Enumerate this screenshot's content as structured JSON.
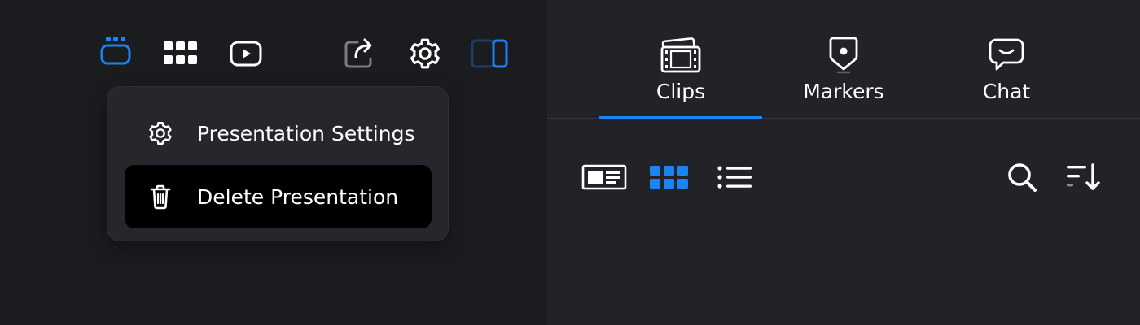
{
  "toolbar": {
    "icons": [
      "sessions-icon",
      "grid-icon",
      "play-icon",
      "share-icon",
      "settings-gear-icon",
      "panel-toggle-icon"
    ]
  },
  "menu": {
    "items": [
      {
        "label": "Presentation Settings",
        "icon": "gear-icon",
        "active": false
      },
      {
        "label": "Delete Presentation",
        "icon": "trash-icon",
        "active": true
      }
    ]
  },
  "tabs": [
    {
      "label": "Clips",
      "icon": "clips-film-icon",
      "selected": true
    },
    {
      "label": "Markers",
      "icon": "marker-pin-icon",
      "selected": false
    },
    {
      "label": "Chat",
      "icon": "chat-bubble-icon",
      "selected": false
    }
  ],
  "view_toolbar": {
    "icons": [
      "card-view-icon",
      "grid-view-icon",
      "list-view-icon",
      "search-icon",
      "sort-icon"
    ],
    "active_view": "grid-view-icon"
  },
  "colors": {
    "accent": "#1a84f0",
    "background_left": "#1b1c1f",
    "background_right": "#222328",
    "menu_bg": "#25272c"
  }
}
